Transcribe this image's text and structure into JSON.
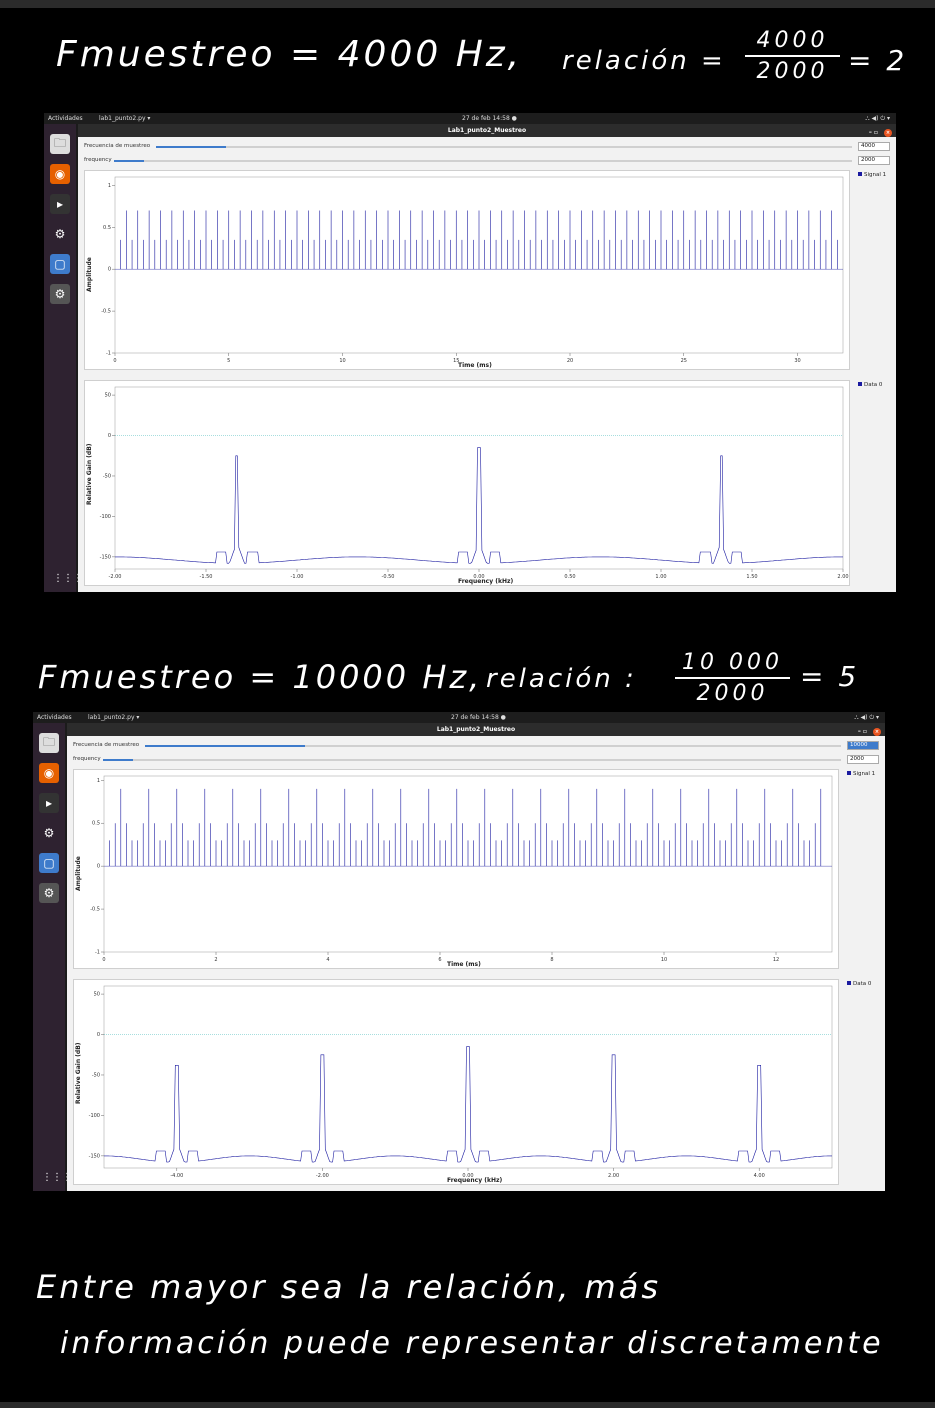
{
  "notes": {
    "heading1": {
      "left": "Fmuestreo = 4000 Hz,",
      "ratio_label": "relación =",
      "num": "4000",
      "den": "2000",
      "result": "= 2"
    },
    "heading2": {
      "left": "Fmuestreo = 10000 Hz,",
      "ratio_label": "relación :",
      "num": "10 000",
      "den": "2000",
      "result": "= 5"
    },
    "conclusion_line1": "Entre mayor sea la relación, más",
    "conclusion_line2": "información puede representar discretamente"
  },
  "desktop": {
    "activities": "Actividades",
    "app_menu": "lab1_punto2.py ▾",
    "clock": "27 de feb  14:58  ●",
    "tray": "⛬ ◀) ⏻ ▾"
  },
  "window": {
    "title": "Lab1_punto2_Muestreo",
    "controls": "–  ▫",
    "close": "×"
  },
  "colors": {
    "trace": "#1a1aa0",
    "slider": "#3e7bcb",
    "accent": "#e95420",
    "dock": "#2e2230"
  },
  "dock_icons": [
    "files-icon",
    "firefox-icon",
    "terminal-icon",
    "gnuradio-icon",
    "screenshot-icon",
    "gnuradio-active-icon"
  ],
  "shots": [
    {
      "sample_rate_label": "Frecuencia de muestreo",
      "sample_rate_value": "4000",
      "sample_rate_fraction": 0.1,
      "frequency_label": "frequency",
      "frequency_value": "2000",
      "frequency_fraction": 0.04,
      "time_legend": "Signal 1",
      "freq_legend": "Data 0",
      "time_xlabel": "Time (ms)",
      "time_ylabel": "Amplitude",
      "freq_xlabel": "Frequency (kHz)",
      "freq_ylabel": "Relative Gain (dB)"
    },
    {
      "sample_rate_label": "Frecuencia de muestreo",
      "sample_rate_value": "10000",
      "sample_rate_fraction": 0.23,
      "frequency_label": "frequency",
      "frequency_value": "2000",
      "frequency_fraction": 0.04,
      "time_legend": "Signal 1",
      "freq_legend": "Data 0",
      "time_xlabel": "Time (ms)",
      "time_ylabel": "Amplitude",
      "freq_xlabel": "Frequency (kHz)",
      "freq_ylabel": "Relative Gain (dB)"
    }
  ],
  "chart_data": [
    {
      "type": "line",
      "title": "",
      "xlabel": "Time (ms)",
      "ylabel": "Amplitude",
      "xlim": [
        0,
        32
      ],
      "ylim": [
        -1,
        1.1
      ],
      "x_ticks": [
        "0",
        "5",
        "10",
        "15",
        "20",
        "25",
        "30"
      ],
      "y_ticks": [
        "1",
        "0.5",
        "0",
        "-0.5",
        "-1"
      ],
      "legend": "top-right",
      "series": [
        {
          "name": "Signal 1",
          "sample_interval_ms": 0.25,
          "pattern": [
            0.35,
            0.7
          ]
        }
      ]
    },
    {
      "type": "line",
      "title": "",
      "xlabel": "Frequency (kHz)",
      "ylabel": "Relative Gain (dB)",
      "xlim": [
        -2,
        2
      ],
      "ylim": [
        -165,
        60
      ],
      "x_ticks": [
        "-2.00",
        "-1.50",
        "-1.00",
        "-0.50",
        "0.00",
        "0.50",
        "1.00",
        "1.50",
        "2.00"
      ],
      "y_ticks": [
        "50",
        "0",
        "-50",
        "-100",
        "-150"
      ],
      "legend": "top-right",
      "series": [
        {
          "name": "Data 0",
          "peaks_khz": [
            -1.33,
            0.0,
            1.33
          ],
          "peaks_db": [
            -25,
            -15,
            -25
          ],
          "floor_db": -152
        }
      ]
    },
    {
      "type": "line",
      "title": "",
      "xlabel": "Time (ms)",
      "ylabel": "Amplitude",
      "xlim": [
        0,
        13
      ],
      "ylim": [
        -1,
        1.05
      ],
      "x_ticks": [
        "0",
        "2",
        "4",
        "6",
        "8",
        "10",
        "12"
      ],
      "y_ticks": [
        "1",
        "0.5",
        "0",
        "-0.5",
        "-1"
      ],
      "legend": "top-right",
      "series": [
        {
          "name": "Signal 1",
          "sample_interval_ms": 0.1,
          "pattern": [
            0.3,
            0.5,
            0.9,
            0.5,
            0.3
          ]
        }
      ]
    },
    {
      "type": "line",
      "title": "",
      "xlabel": "Frequency (kHz)",
      "ylabel": "Relative Gain (dB)",
      "xlim": [
        -5,
        5
      ],
      "ylim": [
        -165,
        60
      ],
      "x_ticks": [
        "-4.00",
        "-2.00",
        "0.00",
        "2.00",
        "4.00"
      ],
      "y_ticks": [
        "50",
        "0",
        "-50",
        "-100",
        "-150"
      ],
      "legend": "top-right",
      "series": [
        {
          "name": "Data 0",
          "peaks_khz": [
            -4.0,
            -2.0,
            0.0,
            2.0,
            4.0
          ],
          "peaks_db": [
            -38,
            -25,
            -15,
            -25,
            -38
          ],
          "floor_db": -152
        }
      ]
    }
  ]
}
